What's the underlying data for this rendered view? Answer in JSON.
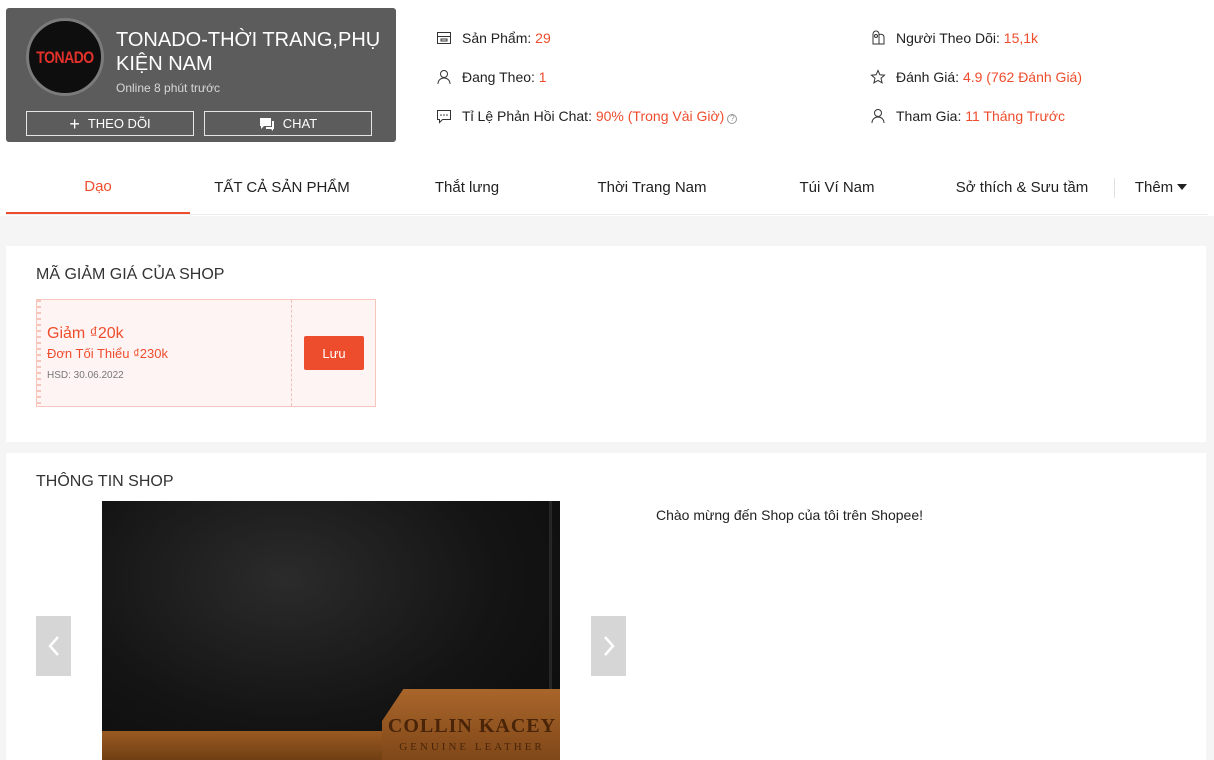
{
  "shop": {
    "logo_text": "TONADO",
    "name": "TONADO-THỜI TRANG,PHỤ KIỆN NAM",
    "online_status": "Online 8 phút trước",
    "follow_label": "THEO DÕI",
    "chat_label": "CHAT"
  },
  "stats": {
    "products_label": "Sản Phẩm:",
    "products_value": "29",
    "following_label": "Đang Theo:",
    "following_value": "1",
    "response_label": "Tỉ Lệ Phản Hồi Chat:",
    "response_value": "90% (Trong Vài Giờ)",
    "followers_label": "Người Theo Dõi:",
    "followers_value": "15,1k",
    "rating_label": "Đánh Giá:",
    "rating_value": "4.9 (762 Đánh Giá)",
    "joined_label": "Tham Gia:",
    "joined_value": "11 Tháng Trước"
  },
  "tabs": [
    {
      "label": "Dạo",
      "active": true
    },
    {
      "label": "TẤT CẢ SẢN PHẨM",
      "active": false
    },
    {
      "label": "Thắt lưng",
      "active": false
    },
    {
      "label": "Thời Trang Nam",
      "active": false
    },
    {
      "label": "Túi Ví Nam",
      "active": false
    },
    {
      "label": "Sở thích & Sưu tầm",
      "active": false
    }
  ],
  "more_tab": "Thêm",
  "voucher_section": {
    "title": "MÃ GIẢM GIÁ CỦA SHOP",
    "voucher": {
      "title": "Giảm ₫20k",
      "min_order": "Đơn Tối Thiểu ₫230k",
      "expiry": "HSD: 30.06.2022",
      "save_label": "Lưu"
    }
  },
  "info_section": {
    "title": "THÔNG TIN SHOP",
    "image_brand": "COLLIN KACEY",
    "image_brand_sub": "GENUINE LEATHER",
    "welcome_text": "Chào mừng đến Shop của tôi trên Shopee!"
  },
  "colors": {
    "accent": "#ee4d2d",
    "header_bg": "#5c5c5c",
    "page_bg": "#f5f5f5"
  },
  "icons": {
    "product": "store-icon",
    "following": "person-icon",
    "response": "chat-bubble-icon",
    "followers": "followers-icon",
    "rating": "star-icon",
    "joined": "person-icon",
    "prev": "chevron-left-icon",
    "next": "chevron-right-icon"
  }
}
